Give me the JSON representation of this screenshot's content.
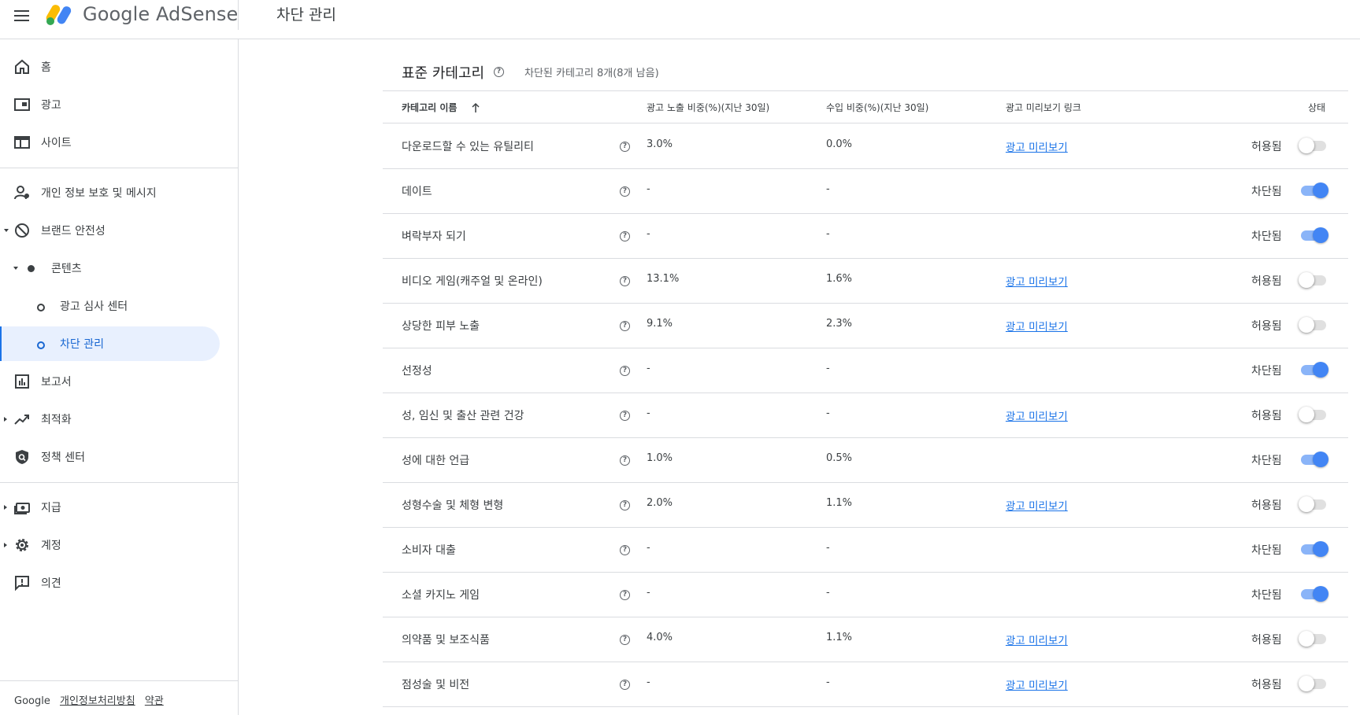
{
  "app": {
    "logo_text": "Google AdSense",
    "page_title": "차단 관리"
  },
  "sidebar": {
    "items": [
      {
        "label": "홈",
        "icon": "home-icon"
      },
      {
        "label": "광고",
        "icon": "ads-icon"
      },
      {
        "label": "사이트",
        "icon": "sites-icon"
      },
      {
        "label": "개인 정보 보호 및 메시지",
        "icon": "privacy-messaging-icon"
      },
      {
        "label": "브랜드 안전성",
        "icon": "block-icon"
      },
      {
        "label": "콘텐츠",
        "icon": "bullet-icon"
      },
      {
        "label": "광고 심사 센터",
        "icon": "ring-bullet-icon"
      },
      {
        "label": "차단 관리",
        "icon": "ring-bullet-icon"
      },
      {
        "label": "보고서",
        "icon": "reports-icon"
      },
      {
        "label": "최적화",
        "icon": "trending-up-icon"
      },
      {
        "label": "정책 센터",
        "icon": "policy-shield-icon"
      },
      {
        "label": "지급",
        "icon": "payments-icon"
      },
      {
        "label": "계정",
        "icon": "settings-gear-icon"
      },
      {
        "label": "의견",
        "icon": "feedback-icon"
      }
    ],
    "footer": {
      "google": "Google",
      "privacy": "개인정보처리방침",
      "terms": "약관"
    }
  },
  "section": {
    "title": "표준 카테고리",
    "subtitle": "차단된 카테고리 8개(8개 남음)"
  },
  "table": {
    "headers": {
      "name": "카테고리 이름",
      "impressions": "광고 노출 비중(%)(지난 30일)",
      "earnings": "수입 비중(%)(지난 30일)",
      "preview": "광고 미리보기 링크",
      "status": "상태"
    },
    "rows": [
      {
        "name": "다운로드할 수 있는 유틸리티",
        "impressions": "3.0%",
        "earnings": "0.0%",
        "preview": "광고 미리보기",
        "status": "허용됨",
        "blocked": false
      },
      {
        "name": "데이트",
        "impressions": "-",
        "earnings": "-",
        "preview": "",
        "status": "차단됨",
        "blocked": true
      },
      {
        "name": "벼락부자 되기",
        "impressions": "-",
        "earnings": "-",
        "preview": "",
        "status": "차단됨",
        "blocked": true
      },
      {
        "name": "비디오 게임(캐주얼 및 온라인)",
        "impressions": "13.1%",
        "earnings": "1.6%",
        "preview": "광고 미리보기",
        "status": "허용됨",
        "blocked": false
      },
      {
        "name": "상당한 피부 노출",
        "impressions": "9.1%",
        "earnings": "2.3%",
        "preview": "광고 미리보기",
        "status": "허용됨",
        "blocked": false
      },
      {
        "name": "선정성",
        "impressions": "-",
        "earnings": "-",
        "preview": "",
        "status": "차단됨",
        "blocked": true
      },
      {
        "name": "성, 임신 및 출산 관련 건강",
        "impressions": "-",
        "earnings": "-",
        "preview": "광고 미리보기",
        "status": "허용됨",
        "blocked": false
      },
      {
        "name": "성에 대한 언급",
        "impressions": "1.0%",
        "earnings": "0.5%",
        "preview": "",
        "status": "차단됨",
        "blocked": true
      },
      {
        "name": "성형수술 및 체형 변형",
        "impressions": "2.0%",
        "earnings": "1.1%",
        "preview": "광고 미리보기",
        "status": "허용됨",
        "blocked": false
      },
      {
        "name": "소비자 대출",
        "impressions": "-",
        "earnings": "-",
        "preview": "",
        "status": "차단됨",
        "blocked": true
      },
      {
        "name": "소셜 카지노 게임",
        "impressions": "-",
        "earnings": "-",
        "preview": "",
        "status": "차단됨",
        "blocked": true
      },
      {
        "name": "의약품 및 보조식품",
        "impressions": "4.0%",
        "earnings": "1.1%",
        "preview": "광고 미리보기",
        "status": "허용됨",
        "blocked": false
      },
      {
        "name": "점성술 및 비전",
        "impressions": "-",
        "earnings": "-",
        "preview": "광고 미리보기",
        "status": "허용됨",
        "blocked": false
      }
    ]
  },
  "colors": {
    "accent": "#1a73e8",
    "toggle_on": "#4285f4",
    "toggle_track_on": "#8ab4f8",
    "active_bg": "#e8f0fe"
  }
}
